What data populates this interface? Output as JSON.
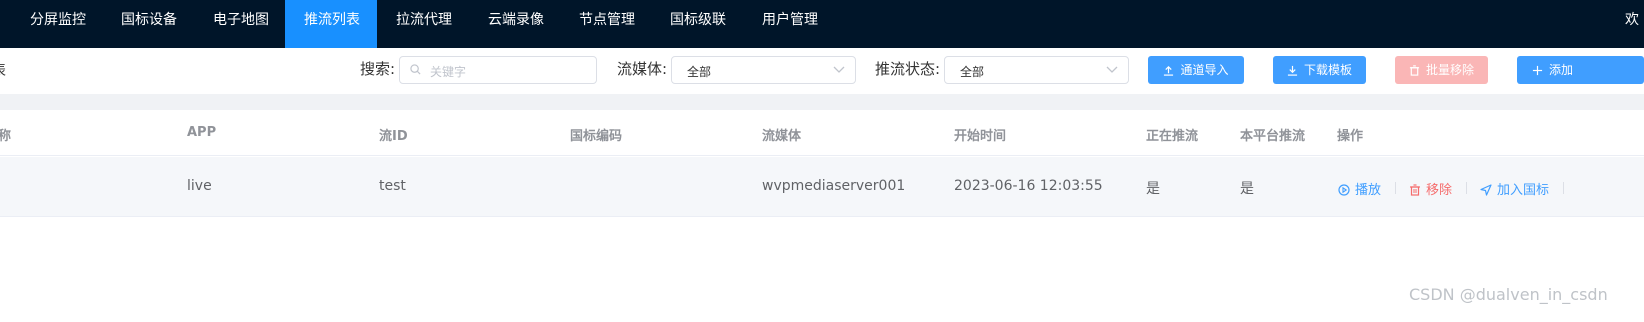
{
  "nav": {
    "items": [
      {
        "label": "分屏监控"
      },
      {
        "label": "国标设备"
      },
      {
        "label": "电子地图"
      },
      {
        "label": "推流列表"
      },
      {
        "label": "拉流代理"
      },
      {
        "label": "云端录像"
      },
      {
        "label": "节点管理"
      },
      {
        "label": "国标级联"
      },
      {
        "label": "用户管理"
      }
    ],
    "active_index": 3,
    "welcome": "欢"
  },
  "toolbar": {
    "left_fragment": "表",
    "search_label": "搜索:",
    "search_placeholder": "关键字",
    "media_label": "流媒体:",
    "media_value": "全部",
    "status_label": "推流状态:",
    "status_value": "全部",
    "import_btn": "通道导入",
    "download_btn": "下载模板",
    "batch_remove_btn": "批量移除",
    "add_btn": "添加"
  },
  "table": {
    "headers": [
      "称",
      "APP",
      "流ID",
      "国标编码",
      "流媒体",
      "开始时间",
      "正在推流",
      "本平台推流",
      "操作"
    ],
    "rows": [
      {
        "name": "",
        "app": "live",
        "stream_id": "test",
        "gb_code": "",
        "media_server": "wvpmediaserver001",
        "start_time": "2023-06-16 12:03:55",
        "pushing": "是",
        "self_platform": "是",
        "actions": {
          "play": "播放",
          "remove": "移除",
          "add_gb": "加入国标"
        }
      }
    ]
  },
  "watermark": "CSDN @dualven_in_csdn",
  "colors": {
    "nav_bg": "#001529",
    "nav_active": "#1890ff",
    "primary": "#409eff",
    "danger": "#f56c6c"
  }
}
